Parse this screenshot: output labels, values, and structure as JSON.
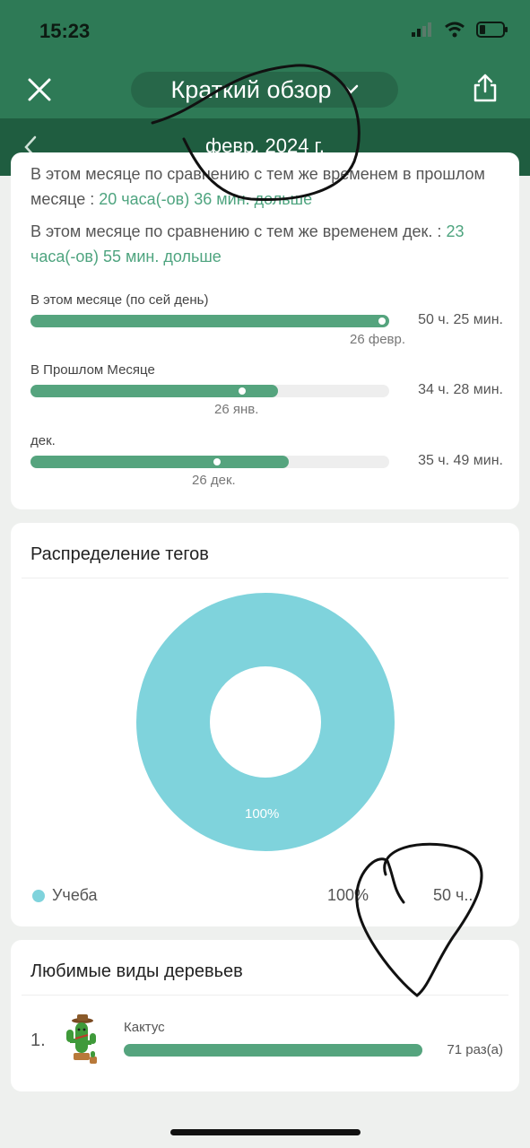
{
  "status": {
    "time": "15:23"
  },
  "header": {
    "title": "Краткий обзор",
    "period": "февр. 2024 г."
  },
  "comparison": {
    "line1_prefix": "В этом месяце по сравнению с тем же временем в прошлом месяце : ",
    "line1_value": "20 часа(-ов) 36 мин. дольше",
    "line2_prefix": "В этом месяце по сравнению с тем же временем дек. : ",
    "line2_value": "23 часа(-ов) 55 мин. дольше"
  },
  "bars": [
    {
      "label": "В этом месяце (по сей день)",
      "value": "50 ч. 25 мин.",
      "date": "26 февр.",
      "fill_fraction": 1.0,
      "marker_fraction": 0.98
    },
    {
      "label": "В Прошлом Месяце",
      "value": "34 ч. 28 мин.",
      "date": "26 янв.",
      "fill_fraction": 0.69,
      "marker_fraction": 0.59
    },
    {
      "label": "дек.",
      "value": "35 ч. 49 мин.",
      "date": "26 дек.",
      "fill_fraction": 0.72,
      "marker_fraction": 0.52
    }
  ],
  "tags": {
    "title": "Распределение тегов",
    "slice_label": "100%",
    "legend": {
      "name": "Учеба",
      "percent": "100%",
      "time": "50 ч..."
    },
    "color": "#7fd3dc"
  },
  "trees": {
    "title": "Любимые виды деревьев",
    "items": [
      {
        "rank": "1.",
        "name": "Кактус",
        "count": "71 раз(а)",
        "fill_fraction": 1.0
      }
    ]
  },
  "colors": {
    "header": "#2e7a56",
    "subheader": "#1f5d40",
    "accent": "#4ea47f",
    "bar": "#55a47e"
  }
}
